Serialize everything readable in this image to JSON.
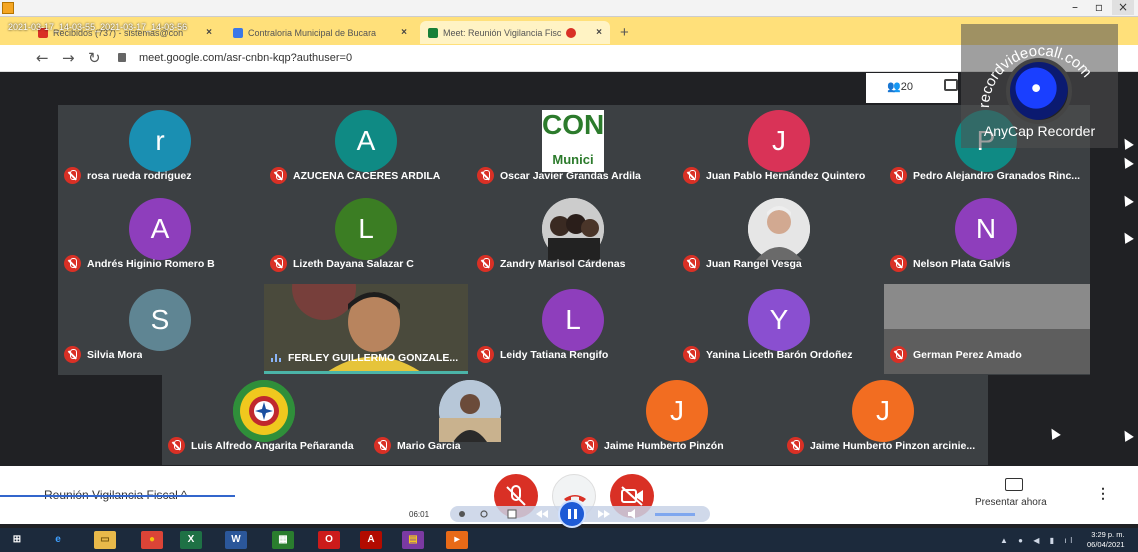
{
  "recording": {
    "stamp": "2021-03-17_14-03-55_2021-03-17_14-03-56",
    "watermark_site": "recordvideocall.com",
    "watermark_app": "AnyCap Recorder"
  },
  "browser": {
    "tabs": [
      {
        "label": "Recibidos (737) - sistemas@con",
        "close": "×"
      },
      {
        "label": "Contraloria Municipal de Bucara",
        "close": "×"
      },
      {
        "label": "Meet: Reunión Vigilancia Fisc",
        "close": "×"
      }
    ],
    "new_tab": "+",
    "nav": {
      "back": "←",
      "forward": "→",
      "reload": "↻"
    },
    "url": "meet.google.com/asr-cnbn-kqp?authuser=0"
  },
  "meet": {
    "people_count": "20",
    "meeting_title": "Reunión Vigilancia Fiscal ^",
    "present_label": "Presentar ahora",
    "participants": [
      {
        "name": "rosa rueda rodriguez",
        "initial": "r",
        "color": "#1a8fb2"
      },
      {
        "name": "AZUCENA CACERES ARDILA",
        "initial": "A",
        "color": "#0f8a84"
      },
      {
        "name": "Oscar Javier Grandas Ardila",
        "initial": "CON",
        "logo_sub": "Munici",
        "color": "#ffffff"
      },
      {
        "name": "Juan Pablo Hernández Quintero",
        "initial": "J",
        "color": "#d93357"
      },
      {
        "name": "Pedro Alejandro Granados Rinc...",
        "initial": "P",
        "color": "#0f8a84"
      },
      {
        "name": "Andrés Higinio Romero B",
        "initial": "A",
        "color": "#8e3ebc"
      },
      {
        "name": "Lizeth Dayana Salazar C",
        "initial": "L",
        "color": "#3b7d23"
      },
      {
        "name": "Zandry Marisol Cárdenas",
        "initial": "",
        "color": "#cfcfcf"
      },
      {
        "name": "Juan Rangel Vesga",
        "initial": "",
        "color": "#e6e6e6"
      },
      {
        "name": "Nelson Plata Galvis",
        "initial": "N",
        "color": "#8e3ebc"
      },
      {
        "name": "Silvia Mora",
        "initial": "S",
        "color": "#5f8593"
      },
      {
        "name": "FERLEY GUILLERMO GONZALE...",
        "initial": "",
        "color": "#8a7b44"
      },
      {
        "name": "Leidy Tatiana Rengifo",
        "initial": "L",
        "color": "#8e3ebc"
      },
      {
        "name": "Yanina Liceth Barón Ordoñez",
        "initial": "Y",
        "color": "#8a4fd0"
      },
      {
        "name": "German Perez Amado",
        "initial": "",
        "color": "#7d7d7d"
      },
      {
        "name": "Luis Alfredo Angarita Peñaranda",
        "initial": "",
        "color": "#2f8f3a"
      },
      {
        "name": "Mario Garcia",
        "initial": "",
        "color": "#b7c7d8"
      },
      {
        "name": "Jaime Humberto Pinzón",
        "initial": "J",
        "color": "#f26d21"
      },
      {
        "name": "Jaime Humberto Pinzon arcinie...",
        "initial": "J",
        "color": "#f26d21"
      }
    ]
  },
  "player": {
    "time": "06:01"
  },
  "taskbar": {
    "time": "3:29 p. m.",
    "date": "06/04/2021",
    "apps": [
      "start",
      "ie",
      "explorer",
      "chrome",
      "excel",
      "word",
      "calc",
      "opera",
      "acrobat",
      "winrar",
      "player"
    ]
  }
}
